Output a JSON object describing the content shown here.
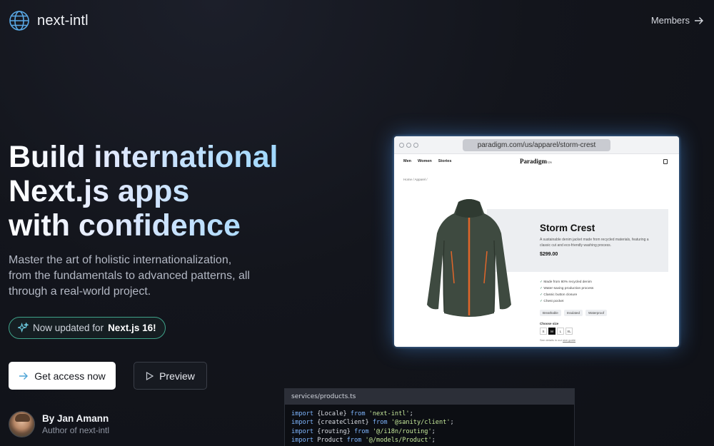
{
  "header": {
    "logo_text": "next-intl",
    "logo_icon": "globe-icon",
    "nav_link": "Members",
    "nav_icon": "arrow-right-icon"
  },
  "hero": {
    "title_lines": [
      "Build international",
      "Next.js apps",
      "with confidence"
    ],
    "subtitle": "Master the art of holistic internationalization, from the fundamentals to advanced patterns, all through a real-world project.",
    "badge_prefix": "Now updated for",
    "badge_highlight": "Next.js 16!",
    "badge_icon": "sparkles-icon",
    "primary_button": "Get access now",
    "primary_icon": "arrow-right-icon",
    "secondary_button": "Preview",
    "secondary_icon": "play-icon"
  },
  "author": {
    "name": "By Jan Amann",
    "role": "Author of next-intl"
  },
  "browser": {
    "url": "paradigm.com/us/apparel/storm-crest",
    "nav": [
      "Men",
      "Women",
      "Stories"
    ],
    "brand": "Paradigm",
    "brand_suffix": "US",
    "breadcrumb": "Home  /  Apparel  /",
    "product": {
      "title": "Storm Crest",
      "description": "A sustainable denim jacket made from recycled materials, featuring a classic cut and eco-friendly washing process.",
      "price": "$299.00",
      "features": [
        "Made from 80% recycled denim",
        "Water-saving production process",
        "Classic button closure",
        "Chest pocket"
      ],
      "tags": [
        "Breathable",
        "Insulated",
        "Waterproof"
      ],
      "size_label": "Choose size",
      "sizes": [
        "S",
        "M",
        "L",
        "XL"
      ],
      "selected_size": "M",
      "size_note": "See details in our",
      "size_note_link": "size guide"
    }
  },
  "code": {
    "filename": "services/products.ts",
    "lines": [
      {
        "kw1": "import",
        "mid": " {Locale} ",
        "kw2": "from",
        "str": " 'next-intl'",
        "end": ";"
      },
      {
        "kw1": "import",
        "mid": " {createClient} ",
        "kw2": "from",
        "str": " '@sanity/client'",
        "end": ";"
      },
      {
        "kw1": "import",
        "mid": " {routing} ",
        "kw2": "from",
        "str": " '@/i18n/routing'",
        "end": ";"
      },
      {
        "kw1": "import",
        "mid": " Product ",
        "kw2": "from",
        "str": " '@/models/Product'",
        "end": ";"
      }
    ]
  },
  "colors": {
    "background": "#13151c",
    "accent_green": "#3fa38a",
    "glow_blue": "#50a0ff"
  }
}
